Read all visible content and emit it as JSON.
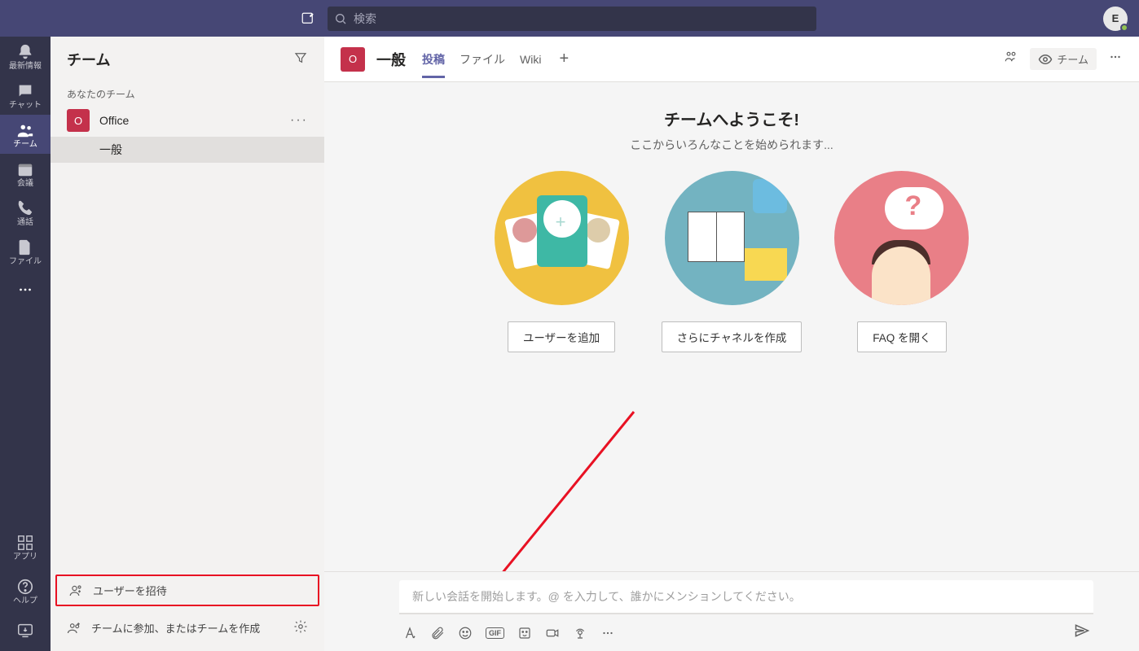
{
  "topbar": {
    "search_placeholder": "検索",
    "avatar_initial": "E"
  },
  "rail": {
    "items": [
      {
        "label": "最新情報"
      },
      {
        "label": "チャット"
      },
      {
        "label": "チーム"
      },
      {
        "label": "会議"
      },
      {
        "label": "通話"
      },
      {
        "label": "ファイル"
      }
    ],
    "bottom": [
      {
        "label": "アプリ"
      },
      {
        "label": "ヘルプ"
      }
    ]
  },
  "pane": {
    "title": "チーム",
    "section_label": "あなたのチーム",
    "team_initial": "O",
    "team_name": "Office",
    "channel_general": "一般",
    "invite_label": "ユーザーを招待",
    "join_create_label": "チームに参加、またはチームを作成"
  },
  "content": {
    "team_initial": "O",
    "channel_name": "一般",
    "tabs": [
      {
        "label": "投稿"
      },
      {
        "label": "ファイル"
      },
      {
        "label": "Wiki"
      }
    ],
    "meet_label": "チーム",
    "welcome_title": "チームへようこそ!",
    "welcome_sub": "ここからいろんなことを始められます...",
    "cards": [
      {
        "button": "ユーザーを追加"
      },
      {
        "button": "さらにチャネルを作成"
      },
      {
        "button": "FAQ を開く"
      }
    ],
    "compose_placeholder": "新しい会話を開始します。@ を入力して、誰かにメンションしてください。"
  }
}
